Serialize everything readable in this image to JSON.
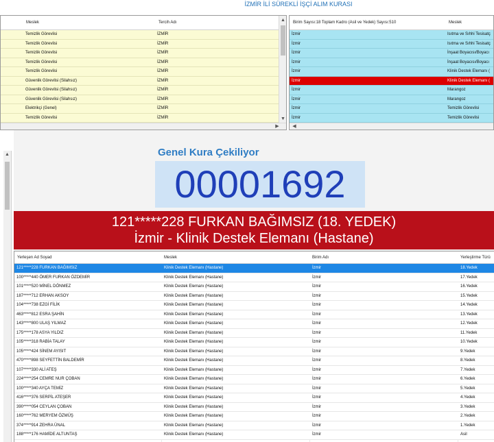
{
  "app": {
    "title": "İZMİR İLİ SÜREKLİ İŞÇİ ALIM KURASI"
  },
  "top_left": {
    "columns": [
      "Meslek",
      "Tercih Adı"
    ],
    "rows": [
      {
        "meslek": "Temizlik Görevlisi",
        "tercih": "İZMİR"
      },
      {
        "meslek": "Temizlik Görevlisi",
        "tercih": "İZMİR"
      },
      {
        "meslek": "Temizlik Görevlisi",
        "tercih": "İZMİR"
      },
      {
        "meslek": "Temizlik Görevlisi",
        "tercih": "İZMİR"
      },
      {
        "meslek": "Temizlik Görevlisi",
        "tercih": "İZMİR"
      },
      {
        "meslek": "Güvenlik Görevlisi (Silahsız)",
        "tercih": "İZMİR"
      },
      {
        "meslek": "Güvenlik Görevlisi (Silahsız)",
        "tercih": "İZMİR"
      },
      {
        "meslek": "Güvenlik Görevlisi (Silahsız)",
        "tercih": "İZMİR"
      },
      {
        "meslek": "Elektrikçi (Genel)",
        "tercih": "İZMİR"
      },
      {
        "meslek": "Temizlik Görevlisi",
        "tercih": "İZMİR"
      }
    ]
  },
  "top_right": {
    "header_info": "Birim Sayısı:18 Toplam Kadro (Asil ve Yedek) Sayısı:510",
    "column_meslek": "Meslek",
    "rows": [
      {
        "birim": "İzmir",
        "meslek": "Isıtma ve Sıhhi Tesisatç",
        "highlight": false
      },
      {
        "birim": "İzmir",
        "meslek": "Isıtma ve Sıhhi Tesisatç",
        "highlight": false
      },
      {
        "birim": "İzmir",
        "meslek": "İnşaat Boyacısı/Boyacı",
        "highlight": false
      },
      {
        "birim": "İzmir",
        "meslek": "İnşaat Boyacısı/Boyacı",
        "highlight": false
      },
      {
        "birim": "İzmir",
        "meslek": "Klinik Destek Elemanı (",
        "highlight": false
      },
      {
        "birim": "İzmir",
        "meslek": "Klinik Destek Elemanı (",
        "highlight": true
      },
      {
        "birim": "İzmir",
        "meslek": "Marangoz",
        "highlight": false
      },
      {
        "birim": "İzmir",
        "meslek": "Marangoz",
        "highlight": false
      },
      {
        "birim": "İzmir",
        "meslek": "Temizlik Görevlisi",
        "highlight": false
      },
      {
        "birim": "İzmir",
        "meslek": "Temizlik Görevlisi",
        "highlight": false
      }
    ]
  },
  "draw": {
    "label": "Genel Kura Çekiliyor",
    "number": "00001692",
    "winner_line1": "121*****228 FURKAN BAĞIMSIZ (18. YEDEK)",
    "winner_line2": "İzmir - Klinik Destek Elemanı (Hastane)"
  },
  "results": {
    "columns": [
      "Yerleşen Ad Soyad",
      "Meslek",
      "Birim Adı",
      "Yerleştirme Türü"
    ],
    "rows": [
      {
        "ad": "121*****228 FURKAN BAĞIMSIZ",
        "meslek": "Klinik Destek Elemanı (Hastane)",
        "birim": "İzmir",
        "tur": "18.Yedek",
        "selected": true
      },
      {
        "ad": "100*****440 ÖMER FURKAN ÖZDEMİR",
        "meslek": "Klinik Destek Elemanı (Hastane)",
        "birim": "İzmir",
        "tur": "17.Yedek",
        "selected": false
      },
      {
        "ad": "101*****520 MİNEL DÖNMEZ",
        "meslek": "Klinik Destek Elemanı (Hastane)",
        "birim": "İzmir",
        "tur": "16.Yedek",
        "selected": false
      },
      {
        "ad": "187*****712 ERHAN AKSOY",
        "meslek": "Klinik Destek Elemanı (Hastane)",
        "birim": "İzmir",
        "tur": "15.Yedek",
        "selected": false
      },
      {
        "ad": "104*****738 EZGİ FİLİK",
        "meslek": "Klinik Destek Elemanı (Hastane)",
        "birim": "İzmir",
        "tur": "14.Yedek",
        "selected": false
      },
      {
        "ad": "463*****812 ESRA ŞAHİN",
        "meslek": "Klinik Destek Elemanı (Hastane)",
        "birim": "İzmir",
        "tur": "13.Yedek",
        "selected": false
      },
      {
        "ad": "143*****800 ULAŞ YILMAZ",
        "meslek": "Klinik Destek Elemanı (Hastane)",
        "birim": "İzmir",
        "tur": "12.Yedek",
        "selected": false
      },
      {
        "ad": "175*****178 ASYA YILDIZ",
        "meslek": "Klinik Destek Elemanı (Hastane)",
        "birim": "İzmir",
        "tur": "11.Yedek",
        "selected": false
      },
      {
        "ad": "105*****318 RABİA TALAY",
        "meslek": "Klinik Destek Elemanı (Hastane)",
        "birim": "İzmir",
        "tur": "10.Yedek",
        "selected": false
      },
      {
        "ad": "105*****424 SİNEM AYISIT",
        "meslek": "Klinik Destek Elemanı (Hastane)",
        "birim": "İzmir",
        "tur": "9.Yedek",
        "selected": false
      },
      {
        "ad": "470*****898 SEYFETTİN BALDEMİR",
        "meslek": "Klinik Destek Elemanı (Hastane)",
        "birim": "İzmir",
        "tur": "8.Yedek",
        "selected": false
      },
      {
        "ad": "107*****330 ALİ ATEŞ",
        "meslek": "Klinik Destek Elemanı (Hastane)",
        "birim": "İzmir",
        "tur": "7.Yedek",
        "selected": false
      },
      {
        "ad": "224*****254 CEMRE NUR ÇOBAN",
        "meslek": "Klinik Destek Elemanı (Hastane)",
        "birim": "İzmir",
        "tur": "6.Yedek",
        "selected": false
      },
      {
        "ad": "100*****340 AYÇA TEMİZ",
        "meslek": "Klinik Destek Elemanı (Hastane)",
        "birim": "İzmir",
        "tur": "5.Yedek",
        "selected": false
      },
      {
        "ad": "416*****376 SERPİL ATEŞER",
        "meslek": "Klinik Destek Elemanı (Hastane)",
        "birim": "İzmir",
        "tur": "4.Yedek",
        "selected": false
      },
      {
        "ad": "390*****054 CEYLAN ÇOBAN",
        "meslek": "Klinik Destek Elemanı (Hastane)",
        "birim": "İzmir",
        "tur": "3.Yedek",
        "selected": false
      },
      {
        "ad": "160*****762 MERYEM ÖZMÜŞ",
        "meslek": "Klinik Destek Elemanı (Hastane)",
        "birim": "İzmir",
        "tur": "2.Yedek",
        "selected": false
      },
      {
        "ad": "374*****914 ZEHRA ÜNAL",
        "meslek": "Klinik Destek Elemanı (Hastane)",
        "birim": "İzmir",
        "tur": "1.Yedek",
        "selected": false
      },
      {
        "ad": "188*****176 HAMİDE ALTUNTAŞ",
        "meslek": "Klinik Destek Elemanı (Hastane)",
        "birim": "İzmir",
        "tur": "Asil",
        "selected": false
      }
    ]
  },
  "colors": {
    "title_blue": "#1e6fb5",
    "number_blue": "#1f3fb8",
    "banner_red": "#b9101a",
    "highlight_red": "#dc0000",
    "select_blue": "#1e87e5",
    "row_yellow": "#fbfbd4",
    "row_cyan": "#a8e4f2"
  },
  "icons": {
    "scroll_up": "▲",
    "scroll_down": "▼",
    "scroll_left": "◀",
    "scroll_right": "▶"
  }
}
